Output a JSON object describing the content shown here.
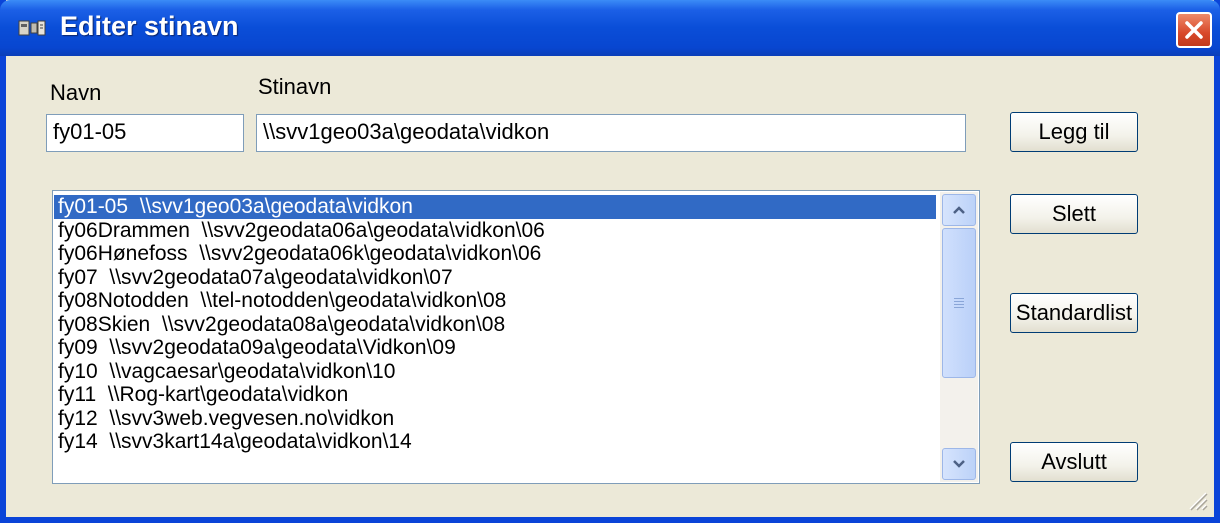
{
  "window": {
    "title": "Editer stinavn",
    "icon": "app-icon",
    "close_icon": "close-icon"
  },
  "form": {
    "navn_label": "Navn",
    "stinavn_label": "Stinavn",
    "navn_value": "fy01-05",
    "stinavn_value": "\\\\svv1geo03a\\geodata\\vidkon"
  },
  "list": {
    "selected_index": 0,
    "items": [
      "fy01-05  \\\\svv1geo03a\\geodata\\vidkon",
      "fy06Drammen  \\\\svv2geodata06a\\geodata\\vidkon\\06",
      "fy06Hønefoss  \\\\svv2geodata06k\\geodata\\vidkon\\06",
      "fy07  \\\\svv2geodata07a\\geodata\\vidkon\\07",
      "fy08Notodden  \\\\tel-notodden\\geodata\\vidkon\\08",
      "fy08Skien  \\\\svv2geodata08a\\geodata\\vidkon\\08",
      "fy09  \\\\svv2geodata09a\\geodata\\Vidkon\\09",
      "fy10  \\\\vagcaesar\\geodata\\vidkon\\10",
      "fy11  \\\\Rog-kart\\geodata\\vidkon",
      "fy12  \\\\svv3web.vegvesen.no\\vidkon",
      "fy14  \\\\svv3kart14a\\geodata\\vidkon\\14"
    ]
  },
  "buttons": {
    "add": "Legg til",
    "delete": "Slett",
    "standard": "Standardlist",
    "exit": "Avslutt"
  },
  "colors": {
    "titlebar": "#0a4ed8",
    "selection": "#316ac5",
    "dialog_bg": "#ece9d8"
  }
}
